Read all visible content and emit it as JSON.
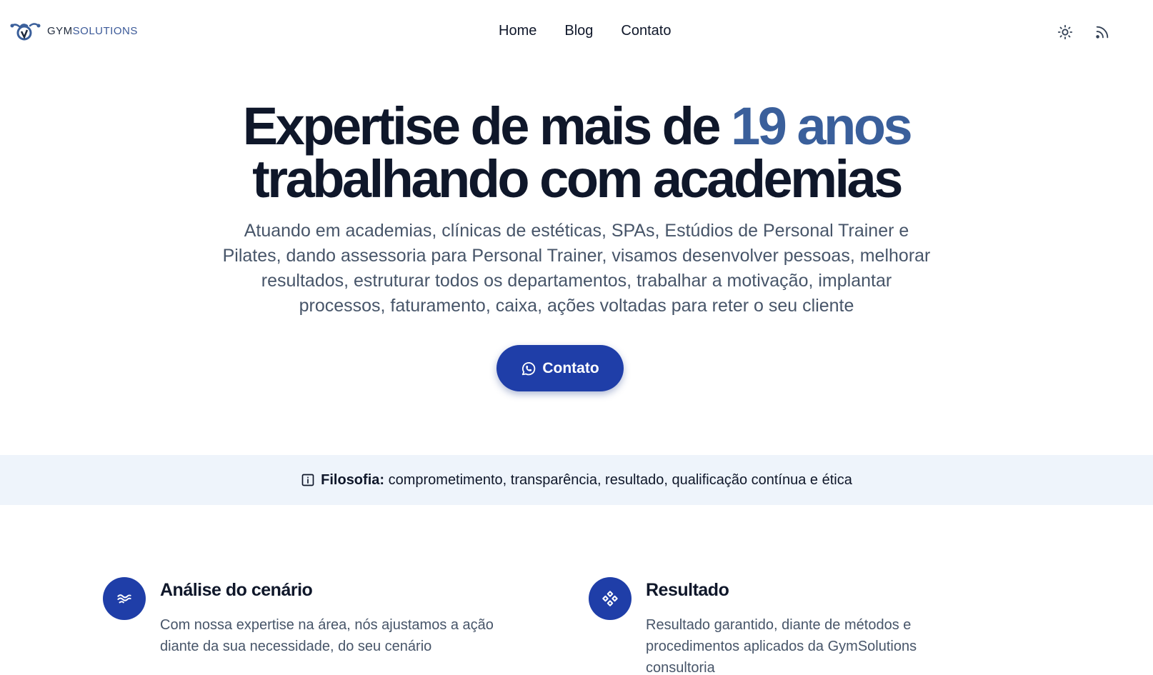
{
  "header": {
    "logo": {
      "text_main": "GYM",
      "text_accent": "SOLUTIONS"
    },
    "nav": [
      {
        "label": "Home"
      },
      {
        "label": "Blog"
      },
      {
        "label": "Contato"
      }
    ],
    "icons": [
      "sun-icon",
      "rss-icon"
    ]
  },
  "hero": {
    "title_line1_prefix": "Expertise de mais de ",
    "title_line1_accent": "19 anos",
    "title_line2": "trabalhando com academias",
    "subtitle": "Atuando em academias, clínicas de estéticas, SPAs, Estúdios de Personal Trainer e Pilates, dando assessoria para Personal Trainer, visamos desenvolver pessoas, melhorar resultados, estruturar todos os departamentos, trabalhar a motivação, implantar processos, faturamento, caixa, ações voltadas para reter o seu cliente",
    "cta_label": "Contato",
    "cta_icon": "whatsapp-icon"
  },
  "banner": {
    "icon": "info-icon",
    "label": "Filosofia:",
    "text": " comprometimento, transparência, resultado, qualificação contínua e ética"
  },
  "features": [
    {
      "icon": "waves-icon",
      "title": "Análise do cenário",
      "text": "Com nossa expertise na área, nós ajustamos a ação diante da sua necessidade, do seu cenário"
    },
    {
      "icon": "components-icon",
      "title": "Resultado",
      "text": "Resultado garantido, diante de métodos e procedimentos aplicados da GymSolutions consultoria"
    }
  ],
  "colors": {
    "primary": "#1f3ea8",
    "accent_text": "#3a5f9b",
    "banner_bg": "#eef4fb",
    "heading": "#0f172a",
    "body_text": "#475569"
  }
}
